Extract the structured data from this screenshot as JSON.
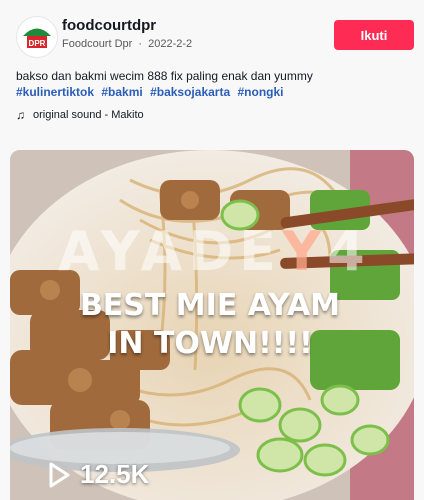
{
  "post": {
    "username": "foodcourtdpr",
    "display_name": "Foodcourt Dpr",
    "separator": "·",
    "date": "2022-2-2",
    "follow_label": "Ikuti",
    "caption": "bakso dan bakmi wecim 888 fix paling enak dan yummy",
    "hashtags": [
      "#kulinertiktok",
      "#bakmi",
      "#baksojakarta",
      "#nongki"
    ],
    "sound": "original sound - Makito",
    "avatar_text": "DPR"
  },
  "video": {
    "watermark_main": "AYADE",
    "watermark_accent": "Y",
    "watermark_end": "4",
    "overlay_line1": "BEST MIE AYAM",
    "overlay_line2": "IN TOWN!!!!",
    "views": "12.5K",
    "play_icon": "play-icon"
  },
  "colors": {
    "follow": "#fe2c55",
    "hashtag": "#2b5db9",
    "text": "#161823"
  }
}
